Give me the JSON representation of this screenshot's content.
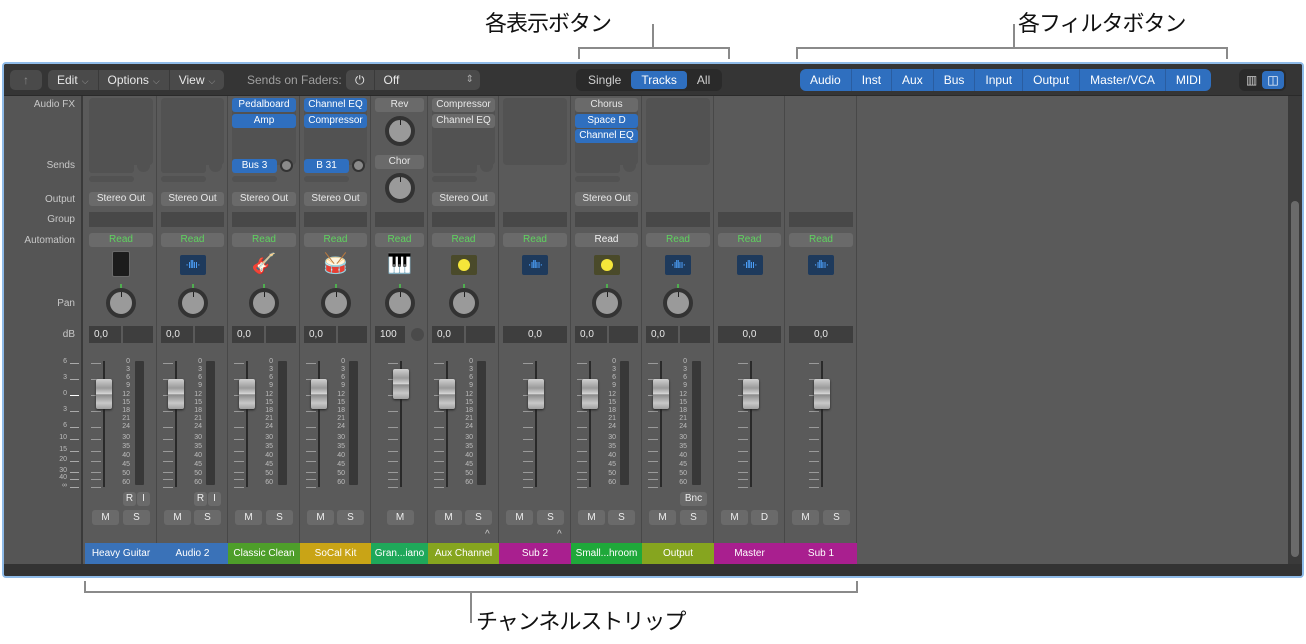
{
  "callouts": {
    "view_buttons": "各表示ボタン",
    "filter_buttons": "各フィルタボタン",
    "channel_strips": "チャンネルストリップ"
  },
  "toolbar": {
    "back_icon": "↑",
    "edit": "Edit",
    "options": "Options",
    "view": "View",
    "sends_on_faders_label": "Sends on Faders:",
    "power_icon": "⏻",
    "sends_value": "Off",
    "view_buttons": [
      {
        "label": "Single",
        "active": false
      },
      {
        "label": "Tracks",
        "active": true
      },
      {
        "label": "All",
        "active": false
      }
    ],
    "filter_buttons": [
      "Audio",
      "Inst",
      "Aux",
      "Bus",
      "Input",
      "Output",
      "Master/VCA",
      "MIDI"
    ],
    "layout_icons": [
      "three-column-icon",
      "two-column-icon"
    ]
  },
  "row_labels": {
    "audio_fx": "Audio FX",
    "sends": "Sends",
    "output": "Output",
    "group": "Group",
    "automation": "Automation",
    "pan": "Pan",
    "db": "dB"
  },
  "fader_scale": [
    "6",
    "3",
    "0",
    "3",
    "6",
    "10",
    "15",
    "20",
    "30",
    "40",
    "∞"
  ],
  "meter_scale": [
    "0",
    "3",
    "6",
    "9",
    "12",
    "15",
    "18",
    "21",
    "24",
    "30",
    "35",
    "40",
    "45",
    "50",
    "60"
  ],
  "strips": [
    {
      "name": "Heavy Guitar",
      "color": "#3a72b8",
      "plugins": [],
      "send": "",
      "output": "Stereo Out",
      "automation": "Read",
      "icon": "amp",
      "pan": true,
      "db": "0,0",
      "meter": true,
      "ri": [
        "R",
        "I"
      ],
      "buttons": [
        "M",
        "S"
      ]
    },
    {
      "name": "Audio 2",
      "color": "#3a72b8",
      "plugins": [],
      "send": "",
      "output": "Stereo Out",
      "automation": "Read",
      "icon": "waveform",
      "pan": true,
      "db": "0,0",
      "meter": true,
      "ri": [
        "R",
        "I"
      ],
      "buttons": [
        "M",
        "S"
      ]
    },
    {
      "name": "Classic Clean",
      "color": "#4e9e2a",
      "plugins": [
        {
          "label": "Pedalboard",
          "blue": true
        },
        {
          "label": "Amp",
          "blue": true
        }
      ],
      "send": "Bus 3",
      "output": "Stereo Out",
      "automation": "Read",
      "icon": "guitar",
      "pan": true,
      "db": "0,0",
      "meter": true,
      "buttons": [
        "M",
        "S"
      ]
    },
    {
      "name": "SoCal Kit",
      "color": "#c9a416",
      "plugins": [
        {
          "label": "Channel EQ",
          "blue": true
        },
        {
          "label": "Compressor",
          "blue": true
        }
      ],
      "send": "B 31",
      "output": "Stereo Out",
      "automation": "Read",
      "icon": "drums",
      "pan": true,
      "db": "0,0",
      "meter": true,
      "buttons": [
        "M",
        "S"
      ]
    },
    {
      "name": "Gran...iano",
      "color": "#1fa85a",
      "plugins": [
        {
          "label": "Rev",
          "blue": false
        },
        {
          "label": "Chor",
          "blue": false
        }
      ],
      "send": "",
      "output": "",
      "automation": "Read",
      "icon": "piano",
      "pan": true,
      "db": "100",
      "meter": false,
      "buttons": [
        "M"
      ]
    },
    {
      "name": "Aux Channel",
      "color": "#86a51f",
      "plugins": [
        {
          "label": "Compressor",
          "blue": false
        },
        {
          "label": "Channel EQ",
          "blue": false
        }
      ],
      "send": "",
      "output": "Stereo Out",
      "automation": "Read",
      "icon": "yellow-knob",
      "pan": true,
      "db": "0,0",
      "meter": true,
      "buttons": [
        "M",
        "S"
      ],
      "caret": true
    },
    {
      "name": "Sub 2",
      "color": "#a91f8f",
      "plugins": [],
      "send": "",
      "output": "",
      "automation": "Read",
      "icon": "waveform",
      "pan": false,
      "db": "0,0",
      "meter": false,
      "buttons": [
        "M",
        "S"
      ],
      "caret": true
    },
    {
      "name": "Small...hroom",
      "color": "#1fa83a",
      "plugins": [
        {
          "label": "Chorus",
          "blue": false
        },
        {
          "label": "Space D",
          "blue": true
        },
        {
          "label": "Channel EQ",
          "blue": true
        }
      ],
      "send": "",
      "output": "Stereo Out",
      "automation": "Read",
      "automation_white": true,
      "icon": "yellow-knob",
      "pan": true,
      "db": "0,0",
      "meter": true,
      "buttons": [
        "M",
        "S"
      ]
    },
    {
      "name": "Output",
      "color": "#86a51f",
      "plugins": [],
      "send": "",
      "output": "",
      "automation": "Read",
      "icon": "waveform",
      "pan": true,
      "db": "0,0",
      "meter": true,
      "bnc": "Bnc",
      "buttons": [
        "M",
        "S"
      ]
    },
    {
      "name": "Master",
      "color": "#a91f8f",
      "plugins": [],
      "send": "",
      "output": "",
      "automation": "Read",
      "icon": "waveform",
      "pan": false,
      "db": "0,0",
      "meter": false,
      "buttons": [
        "M",
        "D"
      ]
    },
    {
      "name": "Sub 1",
      "color": "#a91f8f",
      "plugins": [],
      "send": "",
      "output": "",
      "automation": "Read",
      "icon": "waveform",
      "pan": false,
      "db": "0,0",
      "meter": false,
      "buttons": [
        "M",
        "S"
      ]
    }
  ]
}
